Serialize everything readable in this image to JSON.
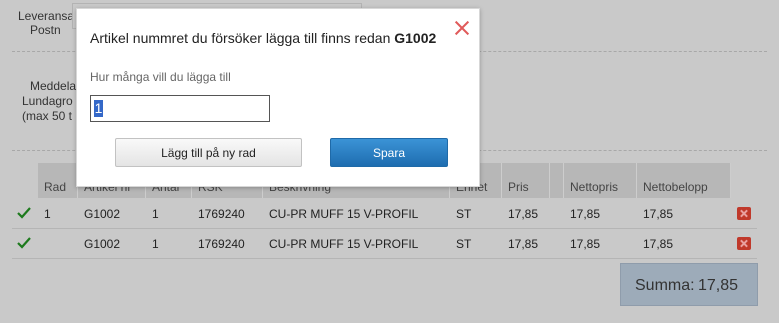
{
  "form": {
    "leverans_label_partial": "Leveransa",
    "post_label_partial": "Postn",
    "meddelande_partial_1": "Meddela",
    "meddelande_partial_2": "Lundagro",
    "meddelande_partial_3": "(max 50 t"
  },
  "table": {
    "headers": {
      "rad": "Rad",
      "artikelnr": "Artikel nr",
      "antal": "Antal",
      "rsk": "RSK",
      "beskrivning": "Beskrivning",
      "enhet": "Enhet",
      "pris": "Pris",
      "nettopris": "Nettopris",
      "nettobelopp": "Nettobelopp"
    },
    "rows": [
      {
        "rad": "1",
        "artikelnr": "G1002",
        "antal": "1",
        "rsk": "1769240",
        "beskrivning": "CU-PR MUFF 15 V-PROFIL",
        "enhet": "ST",
        "pris": "17,85",
        "nettopris": "17,85",
        "nettobelopp": "17,85"
      },
      {
        "rad": "",
        "artikelnr": "G1002",
        "antal": "1",
        "rsk": "1769240",
        "beskrivning": "CU-PR MUFF 15 V-PROFIL",
        "enhet": "ST",
        "pris": "17,85",
        "nettopris": "17,85",
        "nettobelopp": "17,85"
      }
    ]
  },
  "summary": {
    "label": "Summa:",
    "value": "17,85"
  },
  "modal": {
    "title_prefix": "Artikel nummret du försöker lägga till finns redan",
    "title_article": "G1002",
    "question": "Hur många vill du lägga till",
    "quantity_value": "1",
    "add_new_row_label": "Lägg till på ny rad",
    "save_label": "Spara"
  },
  "colors": {
    "overlay": "#c9c9c9",
    "save_button": "#1e6db0",
    "close_icon": "#e05a5a",
    "delete_icon": "#c0392b",
    "check_icon": "#1d7a1d",
    "summary_box": "#9dabb9"
  },
  "icons": {
    "close": "close-icon",
    "check": "checkmark-icon",
    "delete": "delete-icon"
  }
}
